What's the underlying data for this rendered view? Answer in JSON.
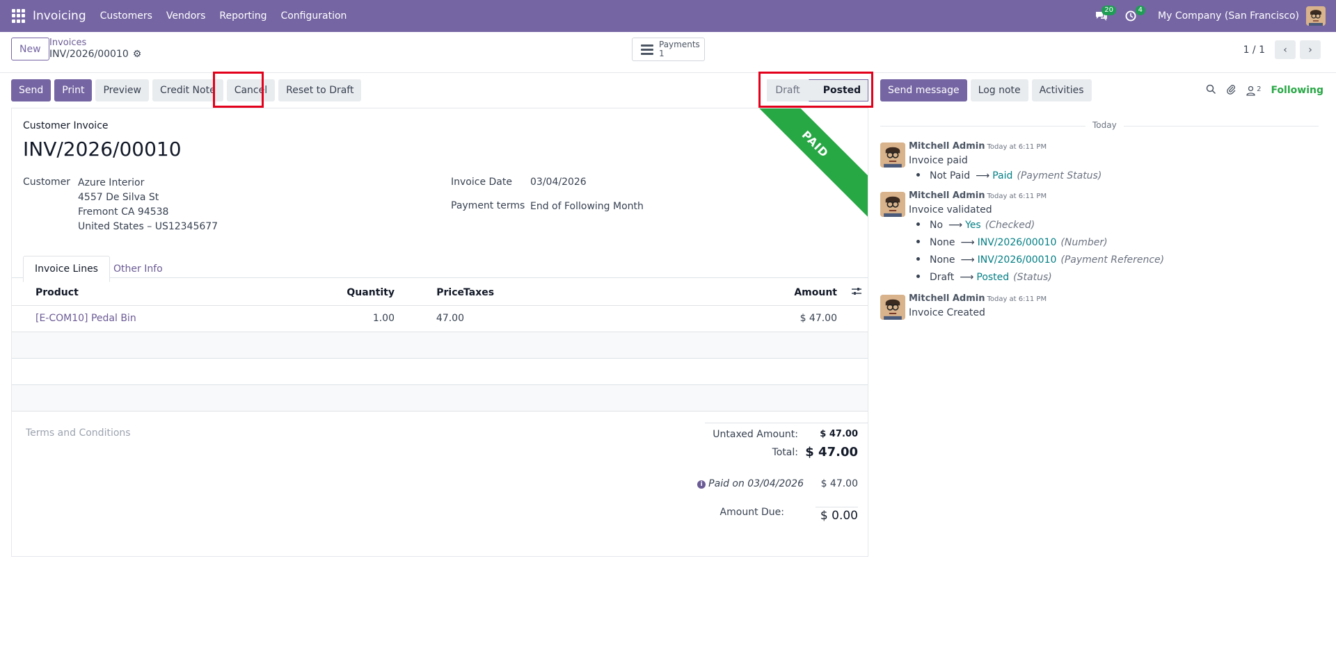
{
  "navbar": {
    "app_name": "Invoicing",
    "menus": [
      "Customers",
      "Vendors",
      "Reporting",
      "Configuration"
    ],
    "messages_count": "20",
    "activities_count": "4",
    "company": "My Company (San Francisco)"
  },
  "control_panel": {
    "new_label": "New",
    "breadcrumb_parent": "Invoices",
    "breadcrumb_current": "INV/2026/00010",
    "smart_button_label": "Payments",
    "smart_button_count": "1",
    "pager_value": "1 / 1"
  },
  "actions": {
    "send": "Send",
    "print": "Print",
    "preview": "Preview",
    "credit_note": "Credit Note",
    "cancel": "Cancel",
    "reset_to_draft": "Reset to Draft"
  },
  "status": {
    "draft": "Draft",
    "posted": "Posted"
  },
  "form": {
    "ribbon": "PAID",
    "doc_type": "Customer Invoice",
    "name": "INV/2026/00010",
    "customer_label": "Customer",
    "customer_name": "Azure Interior",
    "address_line1": "4557 De Silva St",
    "address_line2": "Fremont CA 94538",
    "address_line3": "United States – US12345677",
    "invoice_date_label": "Invoice Date",
    "invoice_date": "03/04/2026",
    "payment_terms_label": "Payment terms",
    "payment_terms": "End of Following Month",
    "tabs": [
      "Invoice Lines",
      "Other Info"
    ],
    "columns": {
      "product": "Product",
      "quantity": "Quantity",
      "price": "Price",
      "taxes": "Taxes",
      "amount": "Amount"
    },
    "lines": [
      {
        "product": "[E-COM10] Pedal Bin",
        "quantity": "1.00",
        "price": "47.00",
        "taxes": "",
        "amount": "$ 47.00"
      }
    ],
    "terms_placeholder": "Terms and Conditions",
    "untaxed_label": "Untaxed Amount:",
    "untaxed_value": "$ 47.00",
    "total_label": "Total:",
    "total_value": "$ 47.00",
    "paid_on": "Paid on 03/04/2026",
    "paid_value": "$ 47.00",
    "amount_due_label": "Amount Due:",
    "amount_due_value": "$ 0.00"
  },
  "chatter": {
    "send_message": "Send message",
    "log_note": "Log note",
    "activities": "Activities",
    "followers_count": "2",
    "following": "Following",
    "day_label": "Today",
    "messages": [
      {
        "author": "Mitchell Admin",
        "time": "Today at 6:11 PM",
        "body": "Invoice paid",
        "tracking": [
          {
            "old": "Not Paid",
            "new": "Paid",
            "field": "(Payment Status)"
          }
        ]
      },
      {
        "author": "Mitchell Admin",
        "time": "Today at 6:11 PM",
        "body": "Invoice validated",
        "tracking": [
          {
            "old": "No",
            "new": "Yes",
            "field": "(Checked)"
          },
          {
            "old": "None",
            "new": "INV/2026/00010",
            "field": "(Number)"
          },
          {
            "old": "None",
            "new": "INV/2026/00010",
            "field": "(Payment Reference)"
          },
          {
            "old": "Draft",
            "new": "Posted",
            "field": "(Status)"
          }
        ]
      },
      {
        "author": "Mitchell Admin",
        "time": "Today at 6:11 PM",
        "body": "Invoice Created",
        "tracking": []
      }
    ]
  },
  "icons": {
    "apps": "apps-grid-icon",
    "messages": "chat-bubbles-icon",
    "activities": "clock-icon",
    "gear": "gear-icon",
    "list": "list-icon",
    "search": "search-icon",
    "attachment": "paperclip-icon",
    "followers": "user-icon",
    "info": "info-icon",
    "settings": "sliders-icon"
  },
  "colors": {
    "brand": "#7565a3",
    "paid_ribbon": "#28a745",
    "highlight": "#e3001b",
    "link": "#6b5b95",
    "tracking_new": "#017e84"
  }
}
